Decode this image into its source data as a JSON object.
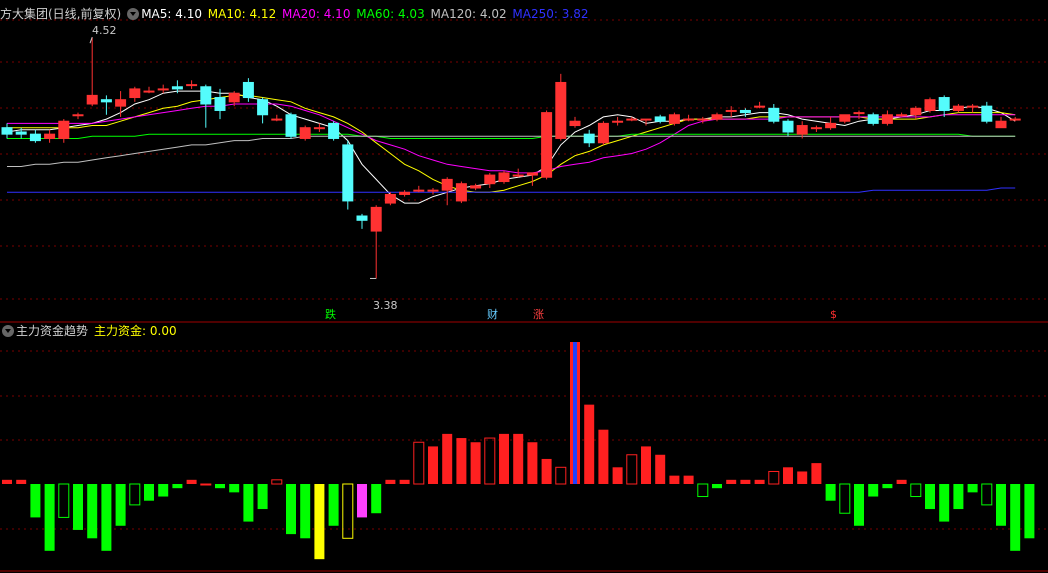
{
  "header": {
    "stock_title": "方大集团(日线,前复权)",
    "ma": [
      {
        "label": "MA5: 4.10",
        "color": "#ffffff"
      },
      {
        "label": "MA10: 4.12",
        "color": "#ffff00"
      },
      {
        "label": "MA20: 4.10",
        "color": "#ff00ff"
      },
      {
        "label": "MA60: 4.03",
        "color": "#00ff00"
      },
      {
        "label": "MA120: 4.02",
        "color": "#c0c0c0"
      },
      {
        "label": "MA250: 3.82",
        "color": "#3030ff"
      }
    ]
  },
  "sub_header": {
    "indicator_title": "主力资金趋势",
    "value_label": "主力资金: 0.00"
  },
  "price_annotations": {
    "high": "4.52",
    "low": "3.38"
  },
  "event_markers": [
    {
      "text": "跌",
      "color": "#00ff00"
    },
    {
      "text": "财",
      "color": "#66ccff"
    },
    {
      "text": "涨",
      "color": "#ff4040"
    },
    {
      "text": "$",
      "color": "#ff3030"
    }
  ],
  "colors": {
    "up": "#ff3232",
    "down": "#54fcfc",
    "ma5": "#ffffff",
    "ma10": "#ffff00",
    "ma20": "#ff00ff",
    "ma60": "#00ff00",
    "ma120": "#c0c0c0",
    "ma250": "#3030ff",
    "grid": "#7a0000",
    "flow_up": "#ff2020",
    "flow_down": "#00ff00"
  },
  "chart_data": [
    {
      "type": "candlestick",
      "title": "方大集团(日线,前复权)",
      "ylim": [
        3.3,
        4.6
      ],
      "grid": true,
      "candles": [
        [
          4.1,
          4.07,
          4.12,
          4.05
        ],
        [
          4.08,
          4.07,
          4.1,
          4.05
        ],
        [
          4.07,
          4.04,
          4.09,
          4.03
        ],
        [
          4.05,
          4.07,
          4.09,
          4.03
        ],
        [
          4.05,
          4.13,
          4.14,
          4.03
        ],
        [
          4.16,
          4.16,
          4.17,
          4.14
        ],
        [
          4.21,
          4.25,
          4.52,
          4.2
        ],
        [
          4.23,
          4.22,
          4.25,
          4.16
        ],
        [
          4.2,
          4.23,
          4.27,
          4.15
        ],
        [
          4.24,
          4.28,
          4.29,
          4.22
        ],
        [
          4.27,
          4.27,
          4.29,
          4.26
        ],
        [
          4.28,
          4.28,
          4.3,
          4.26
        ],
        [
          4.29,
          4.28,
          4.32,
          4.26
        ],
        [
          4.3,
          4.3,
          4.32,
          4.28
        ],
        [
          4.29,
          4.21,
          4.3,
          4.1
        ],
        [
          4.24,
          4.18,
          4.28,
          4.14
        ],
        [
          4.22,
          4.26,
          4.27,
          4.2
        ],
        [
          4.31,
          4.24,
          4.33,
          4.22
        ],
        [
          4.23,
          4.16,
          4.24,
          4.12
        ],
        [
          4.14,
          4.14,
          4.16,
          4.13
        ],
        [
          4.16,
          4.06,
          4.17,
          4.05
        ],
        [
          4.05,
          4.1,
          4.11,
          4.04
        ],
        [
          4.1,
          4.1,
          4.12,
          4.08
        ],
        [
          4.12,
          4.05,
          4.13,
          4.04
        ],
        [
          4.02,
          3.76,
          4.04,
          3.72
        ],
        [
          3.69,
          3.67,
          3.7,
          3.63
        ],
        [
          3.62,
          3.73,
          3.74,
          3.4
        ],
        [
          3.75,
          3.79,
          3.8,
          3.74
        ],
        [
          3.79,
          3.8,
          3.81,
          3.78
        ],
        [
          3.81,
          3.81,
          3.83,
          3.8
        ],
        [
          3.81,
          3.81,
          3.82,
          3.79
        ],
        [
          3.81,
          3.86,
          3.87,
          3.74
        ],
        [
          3.76,
          3.84,
          3.85,
          3.75
        ],
        [
          3.82,
          3.83,
          3.84,
          3.81
        ],
        [
          3.84,
          3.88,
          3.89,
          3.82
        ],
        [
          3.85,
          3.89,
          3.9,
          3.84
        ],
        [
          3.88,
          3.88,
          3.91,
          3.87
        ],
        [
          3.88,
          3.89,
          3.89,
          3.83
        ],
        [
          3.87,
          4.17,
          4.18,
          3.86
        ],
        [
          4.05,
          4.31,
          4.35,
          4.04
        ],
        [
          4.11,
          4.13,
          4.15,
          4.1
        ],
        [
          4.07,
          4.03,
          4.09,
          4.01
        ],
        [
          4.03,
          4.12,
          4.13,
          4.02
        ],
        [
          4.13,
          4.13,
          4.15,
          4.11
        ],
        [
          4.14,
          4.14,
          4.15,
          4.13
        ],
        [
          4.14,
          4.14,
          4.14,
          4.11
        ],
        [
          4.15,
          4.13,
          4.16,
          4.12
        ],
        [
          4.12,
          4.16,
          4.17,
          4.11
        ],
        [
          4.14,
          4.14,
          4.16,
          4.13
        ],
        [
          4.14,
          4.14,
          4.15,
          4.12
        ],
        [
          4.14,
          4.16,
          4.17,
          4.13
        ],
        [
          4.18,
          4.18,
          4.2,
          4.15
        ],
        [
          4.18,
          4.17,
          4.19,
          4.15
        ],
        [
          4.2,
          4.2,
          4.22,
          4.19
        ],
        [
          4.19,
          4.13,
          4.21,
          4.12
        ],
        [
          4.13,
          4.08,
          4.14,
          4.06
        ],
        [
          4.07,
          4.11,
          4.13,
          4.05
        ],
        [
          4.1,
          4.1,
          4.11,
          4.08
        ],
        [
          4.1,
          4.12,
          4.15,
          4.09
        ],
        [
          4.13,
          4.16,
          4.16,
          4.12
        ],
        [
          4.17,
          4.17,
          4.18,
          4.14
        ],
        [
          4.16,
          4.12,
          4.17,
          4.11
        ],
        [
          4.12,
          4.16,
          4.18,
          4.11
        ],
        [
          4.16,
          4.16,
          4.17,
          4.15
        ],
        [
          4.16,
          4.19,
          4.2,
          4.14
        ],
        [
          4.18,
          4.23,
          4.24,
          4.17
        ],
        [
          4.24,
          4.18,
          4.25,
          4.15
        ],
        [
          4.18,
          4.2,
          4.21,
          4.17
        ],
        [
          4.2,
          4.2,
          4.21,
          4.17
        ],
        [
          4.2,
          4.13,
          4.22,
          4.12
        ],
        [
          4.1,
          4.13,
          4.15,
          4.1
        ],
        [
          4.14,
          4.14,
          4.15,
          4.13
        ]
      ],
      "ma_series": [
        {
          "name": "MA5",
          "values": [
            4.08,
            4.09,
            4.09,
            4.09,
            4.1,
            4.11,
            4.12,
            4.14,
            4.17,
            4.21,
            4.23,
            4.26,
            4.27,
            4.27,
            4.27,
            4.26,
            4.26,
            4.24,
            4.23,
            4.2,
            4.16,
            4.14,
            4.12,
            4.1,
            4.04,
            3.93,
            3.86,
            3.79,
            3.75,
            3.75,
            3.78,
            3.8,
            3.82,
            3.83,
            3.84,
            3.86,
            3.87,
            3.88,
            3.92,
            4.02,
            4.08,
            4.11,
            4.15,
            4.16,
            4.15,
            4.12,
            4.13,
            4.13,
            4.14,
            4.14,
            4.15,
            4.15,
            4.16,
            4.17,
            4.17,
            4.16,
            4.14,
            4.13,
            4.12,
            4.11,
            4.13,
            4.14,
            4.14,
            4.15,
            4.16,
            4.18,
            4.18,
            4.19,
            4.2,
            4.19,
            4.17,
            4.13
          ]
        },
        {
          "name": "MA10",
          "values": [
            4.1,
            4.1,
            4.1,
            4.1,
            4.1,
            4.1,
            4.11,
            4.11,
            4.13,
            4.15,
            4.17,
            4.19,
            4.2,
            4.22,
            4.23,
            4.24,
            4.25,
            4.25,
            4.24,
            4.23,
            4.22,
            4.19,
            4.17,
            4.15,
            4.12,
            4.08,
            4.03,
            3.98,
            3.93,
            3.9,
            3.86,
            3.83,
            3.81,
            3.8,
            3.8,
            3.81,
            3.83,
            3.85,
            3.88,
            3.93,
            3.97,
            3.99,
            4.02,
            4.04,
            4.06,
            4.08,
            4.1,
            4.12,
            4.14,
            4.14,
            4.14,
            4.14,
            4.14,
            4.15,
            4.15,
            4.15,
            4.15,
            4.15,
            4.15,
            4.15,
            4.15,
            4.14,
            4.14,
            4.14,
            4.14,
            4.15,
            4.16,
            4.17,
            4.17,
            4.17,
            4.17,
            4.16
          ]
        },
        {
          "name": "MA20",
          "values": [
            4.12,
            4.12,
            4.12,
            4.12,
            4.12,
            4.12,
            4.12,
            4.13,
            4.14,
            4.15,
            4.16,
            4.17,
            4.18,
            4.19,
            4.2,
            4.2,
            4.21,
            4.21,
            4.21,
            4.21,
            4.2,
            4.18,
            4.16,
            4.13,
            4.1,
            4.07,
            4.04,
            4.02,
            4.0,
            3.97,
            3.95,
            3.93,
            3.92,
            3.91,
            3.9,
            3.9,
            3.89,
            3.89,
            3.9,
            3.92,
            3.93,
            3.94,
            3.96,
            3.97,
            3.98,
            4.0,
            4.03,
            4.07,
            4.11,
            4.13,
            4.14,
            4.14,
            4.14,
            4.14,
            4.14,
            4.15,
            4.15,
            4.15,
            4.15,
            4.15,
            4.15,
            4.15,
            4.15,
            4.15,
            4.15,
            4.15,
            4.16,
            4.16,
            4.16,
            4.16,
            4.16,
            4.16
          ]
        },
        {
          "name": "MA60",
          "values": [
            4.05,
            4.05,
            4.05,
            4.05,
            4.05,
            4.05,
            4.06,
            4.06,
            4.06,
            4.06,
            4.07,
            4.07,
            4.07,
            4.07,
            4.07,
            4.07,
            4.07,
            4.07,
            4.07,
            4.07,
            4.07,
            4.07,
            4.07,
            4.07,
            4.07,
            4.06,
            4.06,
            4.05,
            4.05,
            4.05,
            4.05,
            4.05,
            4.05,
            4.05,
            4.05,
            4.05,
            4.05,
            4.05,
            4.06,
            4.06,
            4.06,
            4.06,
            4.06,
            4.06,
            4.07,
            4.07,
            4.07,
            4.07,
            4.07,
            4.07,
            4.07,
            4.07,
            4.07,
            4.07,
            4.07,
            4.07,
            4.07,
            4.07,
            4.07,
            4.07,
            4.07,
            4.07,
            4.07,
            4.07,
            4.07,
            4.07,
            4.07,
            4.07,
            4.06,
            4.06,
            4.06,
            4.06
          ]
        },
        {
          "name": "MA120",
          "values": [
            3.92,
            3.92,
            3.93,
            3.93,
            3.94,
            3.94,
            3.95,
            3.96,
            3.97,
            3.98,
            3.99,
            4.0,
            4.01,
            4.02,
            4.02,
            4.03,
            4.04,
            4.04,
            4.05,
            4.05,
            4.05,
            4.06,
            4.06,
            4.06,
            4.06,
            4.06,
            4.06,
            4.06,
            4.06,
            4.06,
            4.06,
            4.06,
            4.06,
            4.06,
            4.06,
            4.06,
            4.06,
            4.06,
            4.06,
            4.06,
            4.06,
            4.06,
            4.06,
            4.06,
            4.06,
            4.06,
            4.06,
            4.06,
            4.06,
            4.06,
            4.06,
            4.06,
            4.06,
            4.06,
            4.06,
            4.06,
            4.06,
            4.06,
            4.06,
            4.06,
            4.06,
            4.06,
            4.06,
            4.06,
            4.06,
            4.06,
            4.06,
            4.06,
            4.06,
            4.06,
            4.06,
            4.06
          ]
        },
        {
          "name": "MA250",
          "values": [
            3.8,
            3.8,
            3.8,
            3.8,
            3.8,
            3.8,
            3.8,
            3.8,
            3.8,
            3.8,
            3.8,
            3.8,
            3.8,
            3.8,
            3.8,
            3.8,
            3.8,
            3.8,
            3.8,
            3.8,
            3.8,
            3.8,
            3.8,
            3.8,
            3.8,
            3.8,
            3.8,
            3.8,
            3.8,
            3.8,
            3.8,
            3.8,
            3.8,
            3.8,
            3.8,
            3.8,
            3.8,
            3.8,
            3.8,
            3.8,
            3.8,
            3.8,
            3.8,
            3.8,
            3.8,
            3.8,
            3.8,
            3.8,
            3.8,
            3.8,
            3.8,
            3.8,
            3.8,
            3.8,
            3.8,
            3.8,
            3.8,
            3.8,
            3.8,
            3.8,
            3.8,
            3.81,
            3.81,
            3.81,
            3.81,
            3.81,
            3.81,
            3.81,
            3.81,
            3.81,
            3.82,
            3.82
          ]
        }
      ]
    },
    {
      "type": "bar",
      "title": "主力资金趋势",
      "ylim": [
        -1.8,
        3.4
      ],
      "values": [
        0.1,
        0.1,
        -0.8,
        -1.6,
        -0.8,
        -1.1,
        -1.3,
        -1.6,
        -1.0,
        -0.5,
        -0.4,
        -0.3,
        -0.1,
        0.1,
        0,
        -0.1,
        -0.2,
        -0.9,
        -0.6,
        0.1,
        -1.2,
        -1.3,
        -1.8,
        -1.0,
        -1.3,
        -0.8,
        -0.7,
        0.1,
        0.1,
        1.0,
        0.9,
        1.2,
        1.1,
        1.0,
        1.1,
        1.2,
        1.2,
        1.0,
        0.6,
        0.4,
        3.4,
        1.9,
        1.3,
        0.4,
        0.7,
        0.9,
        0.7,
        0.2,
        0.2,
        -0.3,
        -0.1,
        0.1,
        0.1,
        0.1,
        0.3,
        0.4,
        0.3,
        0.5,
        -0.4,
        -0.7,
        -1.0,
        -0.3,
        -0.1,
        0.1,
        -0.3,
        -0.6,
        -0.9,
        -0.6,
        -0.2,
        -0.5,
        -1.0,
        -1.6,
        -1.3
      ]
    }
  ]
}
